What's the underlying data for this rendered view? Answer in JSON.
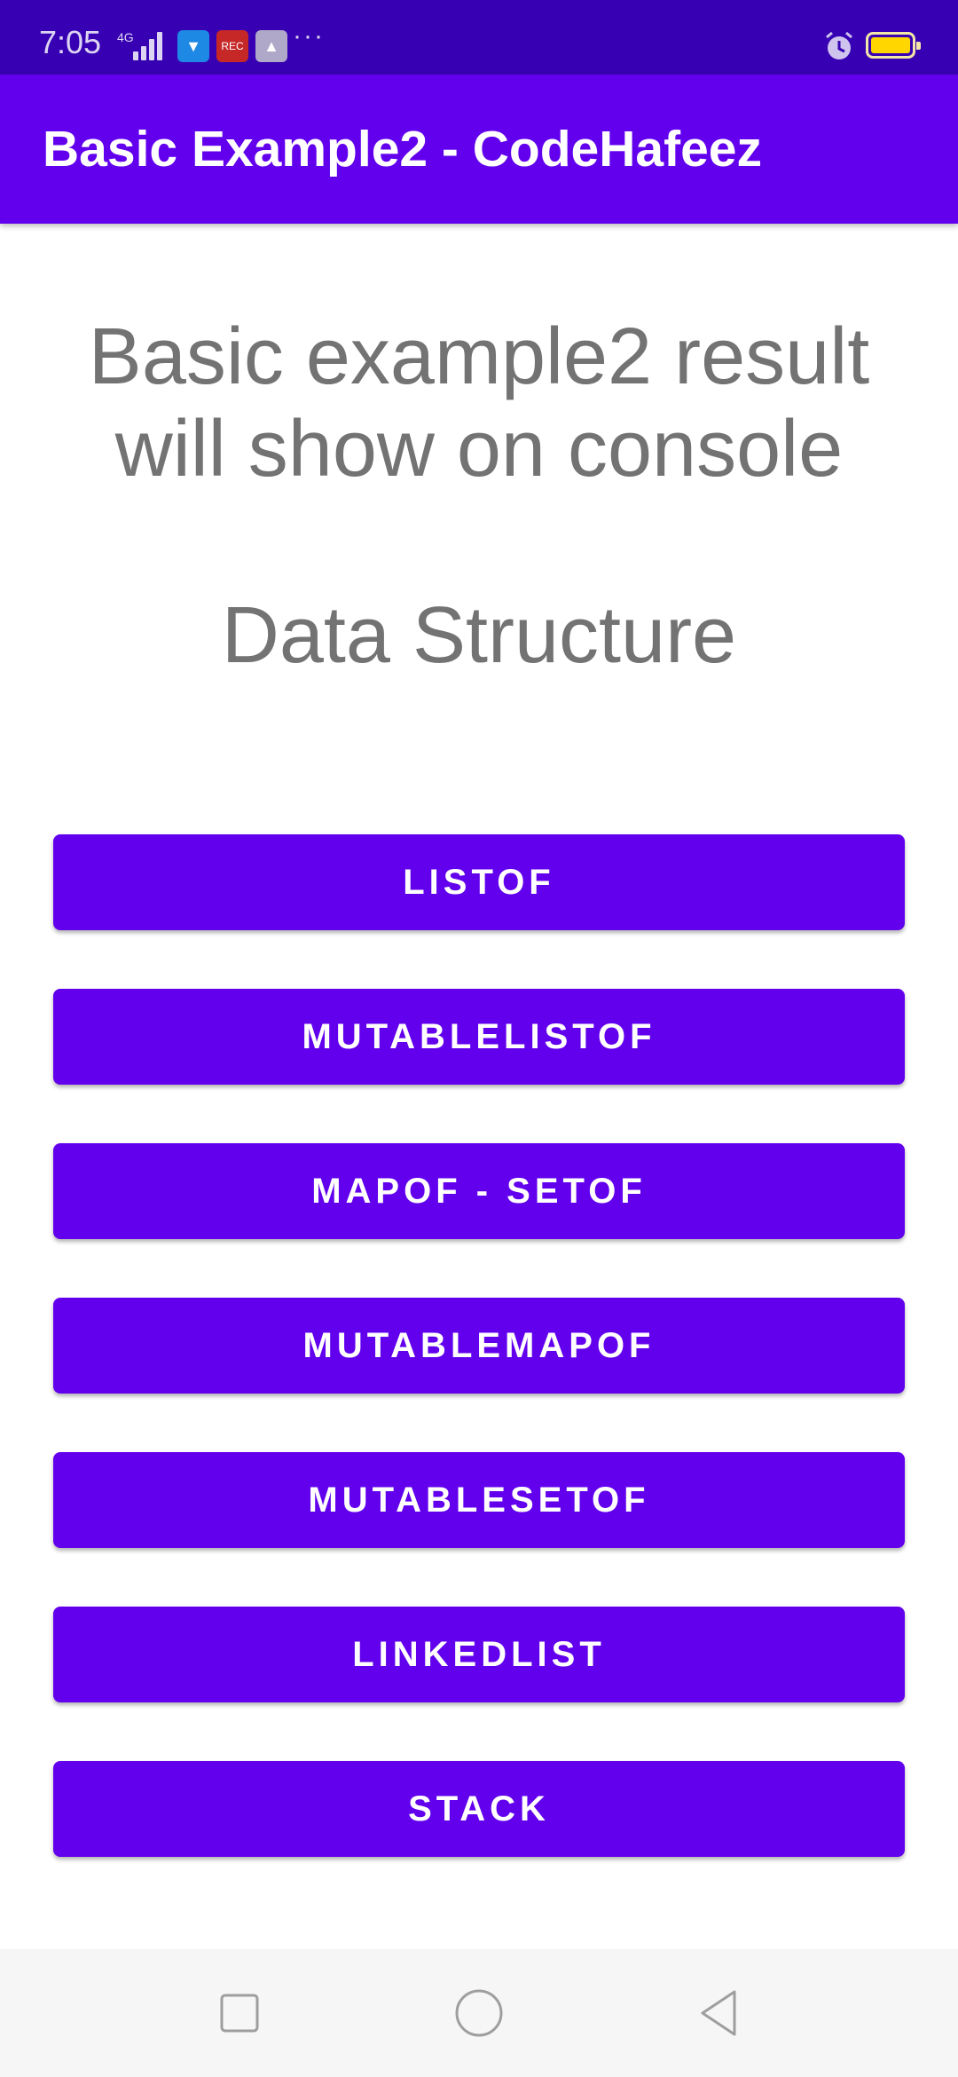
{
  "status_bar": {
    "time": "7:05",
    "network": "4G",
    "icons": [
      "signal-icon",
      "usb-icon",
      "screen-record-icon",
      "drive-icon",
      "more-icon",
      "alarm-icon",
      "battery-icon"
    ],
    "more": "···"
  },
  "app_bar": {
    "title": "Basic Example2 - CodeHafeez",
    "color": "#6200ee"
  },
  "main": {
    "description": "Basic example2 result will show on console",
    "section_title": "Data Structure",
    "buttons": [
      {
        "label": "LISTOF"
      },
      {
        "label": "MUTABLELISTOF"
      },
      {
        "label": "MAPOF - SETOF"
      },
      {
        "label": "MUTABLEMAPOF"
      },
      {
        "label": "MUTABLESETOF"
      },
      {
        "label": "LINKEDLIST"
      },
      {
        "label": "STACK"
      }
    ]
  },
  "nav_bar": {
    "icons": [
      "recents-icon",
      "home-icon",
      "back-icon"
    ]
  },
  "colors": {
    "status_bar": "#3700b3",
    "primary": "#6200ee",
    "body_text": "#737373"
  }
}
